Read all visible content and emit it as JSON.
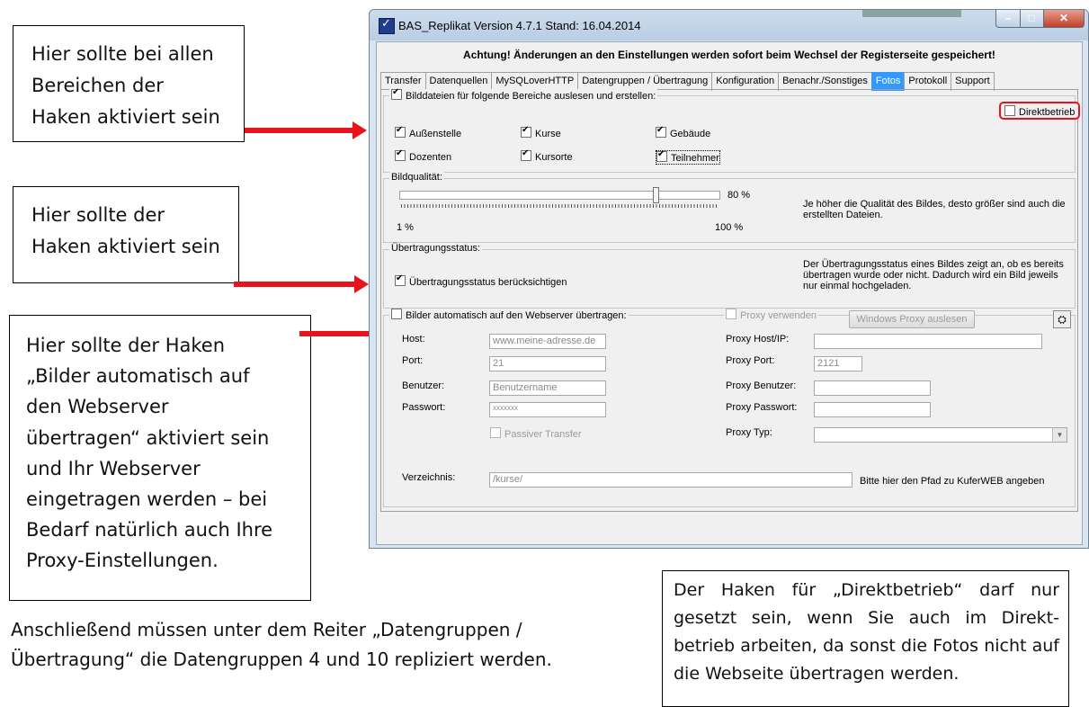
{
  "callouts": {
    "c1": [
      "Hier sollte bei allen",
      "Bereichen der",
      "Haken aktiviert sein"
    ],
    "c2": [
      "Hier sollte der",
      "Haken aktiviert sein"
    ],
    "c3": [
      "Hier sollte der Haken",
      "„Bilder automatisch auf",
      "den Webserver",
      "übertragen“ aktiviert sein",
      "und Ihr Webserver",
      "eingetragen werden – bei",
      "Bedarf natürlich auch Ihre",
      "Proxy-Einstellungen."
    ],
    "c4": "Der Haken für „Direktbetrieb“ darf nur gesetzt sein, wenn Sie auch im Direkt-betrieb arbeiten, da sonst die Fotos nicht auf die Webseite übertragen werden."
  },
  "footer": [
    "Anschließend müssen unter dem Reiter „Datengruppen /",
    "Übertragung“ die Datengruppen 4 und 10 repliziert werden."
  ],
  "window": {
    "title": "BAS_Replikat Version 4.7.1 Stand: 16.04.2014",
    "warning": "Achtung! Änderungen an den Einstellungen werden sofort beim Wechsel der Registerseite gespeichert!",
    "tabs": [
      "Transfer",
      "Datenquellen",
      "MySQLoverHTTP",
      "Datengruppen / Übertragung",
      "Konfiguration",
      "Benachr./Sonstiges",
      "Fotos",
      "Protokoll",
      "Support"
    ],
    "active_tab": "Fotos",
    "bilddateien": {
      "title": "Bilddateien für folgende Bereiche auslesen und erstellen:",
      "checked": true,
      "items": [
        "Außenstelle",
        "Kurse",
        "Gebäude",
        "Dozenten",
        "Kursorte",
        "Teilnehmer"
      ]
    },
    "direktbetrieb": {
      "label": "Direktbetrieb",
      "checked": false
    },
    "bildqualitaet": {
      "title": "Bildqualität:",
      "value_label": "80 %",
      "value": 80,
      "min_label": "1 %",
      "max_label": "100 %",
      "hint": "Je höher die Qualität des Bildes, desto größer sind auch die erstellten Dateien."
    },
    "uebertragungsstatus": {
      "title": "Übertragungsstatus:",
      "checkbox": "Übertragungsstatus berücksichtigen",
      "checked": true,
      "hint": "Der Übertragungsstatus eines Bildes zeigt an, ob es bereits übertragen wurde oder nicht. Dadurch wird ein Bild jeweils nur einmal hochgeladen."
    },
    "webserver": {
      "title": "Bilder automatisch auf den Webserver übertragen:",
      "checked": false,
      "proxy_checkbox": "Proxy verwenden",
      "proxy_button": "Windows Proxy auslesen",
      "host_label": "Host:",
      "host_value": "www.meine-adresse.de",
      "port_label": "Port:",
      "port_value": "21",
      "user_label": "Benutzer:",
      "user_value": "Benutzername",
      "pass_label": "Passwort:",
      "pass_value": "xxxxxxx",
      "passive_label": "Passiver Transfer",
      "proxy_host_label": "Proxy Host/IP:",
      "proxy_host_value": "",
      "proxy_port_label": "Proxy Port:",
      "proxy_port_value": "2121",
      "proxy_user_label": "Proxy Benutzer:",
      "proxy_user_value": "",
      "proxy_pass_label": "Proxy Passwort:",
      "proxy_pass_value": "",
      "proxy_type_label": "Proxy Typ:",
      "proxy_type_value": "",
      "dir_label": "Verzeichnis:",
      "dir_value": "/kurse/",
      "dir_hint": "Bitte hier den Pfad zu KuferWEB angeben"
    }
  },
  "colors": {
    "accent": "#e8131b",
    "tab_active": "#3399ff"
  }
}
